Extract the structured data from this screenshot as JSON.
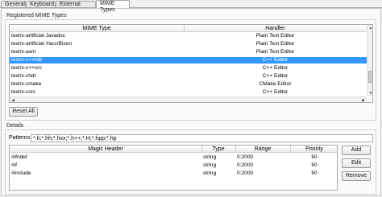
{
  "tabs": [
    "General",
    "Keyboard",
    "External Tools",
    "MIME Types"
  ],
  "registered": {
    "title": "Registered MIME Types",
    "columns": [
      "MIME Type",
      "Handler"
    ],
    "rows": [
      {
        "type": "text/x-artificial-Javadoc",
        "handler": "Plain Text Editor"
      },
      {
        "type": "text/x-artificial-Yacc/Bison",
        "handler": "Plain Text Editor"
      },
      {
        "type": "text/x-asm",
        "handler": "Plain Text Editor"
      },
      {
        "type": "text/x-c++hdr",
        "handler": "C++ Editor"
      },
      {
        "type": "text/x-c++src",
        "handler": "C++ Editor"
      },
      {
        "type": "text/x-chdr",
        "handler": "C++ Editor"
      },
      {
        "type": "text/x-cmake",
        "handler": "CMake Editor"
      },
      {
        "type": "text/x-csrc",
        "handler": "C++ Editor"
      }
    ],
    "selected_row": 3,
    "reset_label": "Reset All"
  },
  "details": {
    "title": "Details",
    "patterns_label": "Patterns:",
    "patterns_value": "*.h;*.hh;*.hxx;*.h++;*.H;*.hpp;*.hp",
    "columns": [
      "Magic Header",
      "Type",
      "Range",
      "Priority"
    ],
    "rows": [
      {
        "header": "#ifndef",
        "type": "string",
        "range": "0:2000",
        "priority": "50"
      },
      {
        "header": "#if",
        "type": "string",
        "range": "0:2000",
        "priority": "50"
      },
      {
        "header": "#include",
        "type": "string",
        "range": "0:2000",
        "priority": "50"
      }
    ],
    "buttons": {
      "add": "Add",
      "edit": "Edit",
      "remove": "Remove"
    }
  },
  "colors": {
    "selection": "#3399ff"
  }
}
